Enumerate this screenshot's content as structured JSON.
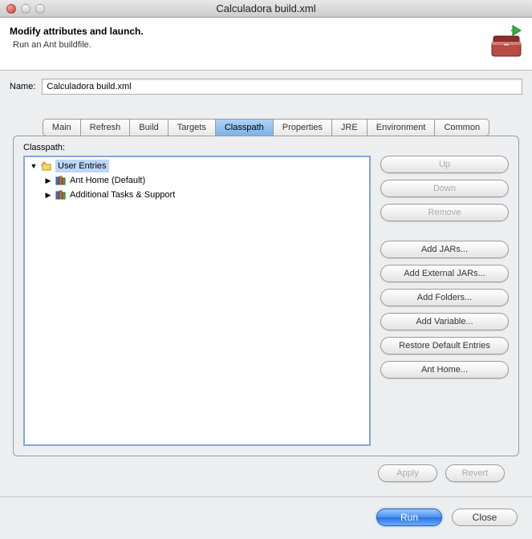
{
  "window": {
    "title": "Calculadora build.xml"
  },
  "header": {
    "title": "Modify attributes and launch.",
    "subtitle": "Run an Ant buildfile."
  },
  "name_field": {
    "label": "Name:",
    "value": "Calculadora build.xml"
  },
  "tabs": [
    {
      "label": "Main"
    },
    {
      "label": "Refresh"
    },
    {
      "label": "Build"
    },
    {
      "label": "Targets"
    },
    {
      "label": "Classpath"
    },
    {
      "label": "Properties"
    },
    {
      "label": "JRE"
    },
    {
      "label": "Environment"
    },
    {
      "label": "Common"
    }
  ],
  "classpath": {
    "label": "Classpath:",
    "entries": {
      "root": "User Entries",
      "child1": "Ant Home (Default)",
      "child2": "Additional Tasks & Support"
    }
  },
  "buttons": {
    "up": "Up",
    "down": "Down",
    "remove": "Remove",
    "add_jars": "Add JARs...",
    "add_external_jars": "Add External JARs...",
    "add_folders": "Add Folders...",
    "add_variable": "Add Variable...",
    "restore_defaults": "Restore Default Entries",
    "ant_home": "Ant Home...",
    "apply": "Apply",
    "revert": "Revert",
    "run": "Run",
    "close": "Close"
  }
}
